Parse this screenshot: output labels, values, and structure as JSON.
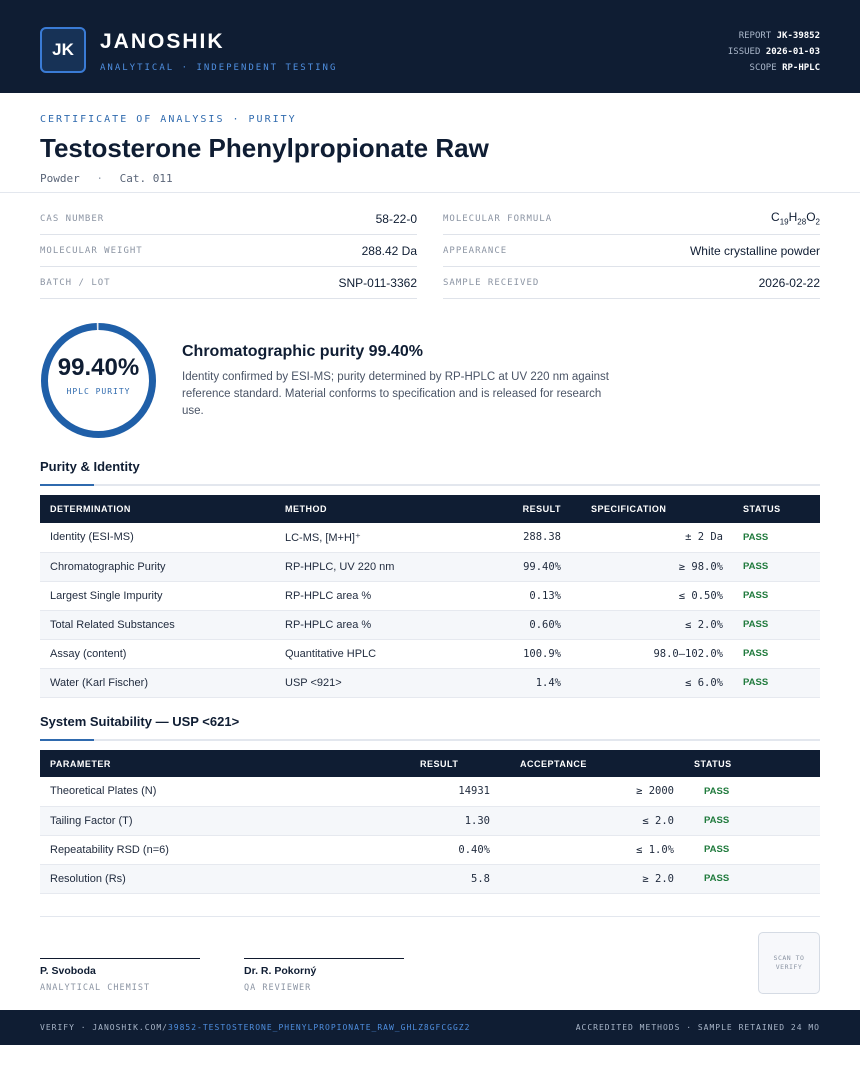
{
  "header": {
    "logo_initials": "JK",
    "brand": "JANOSHIK",
    "tagline": "ANALYTICAL · INDEPENDENT TESTING",
    "report_label": "REPORT",
    "report_value": "JK-39852",
    "issued_label": "ISSUED",
    "issued_value": "2026-01-03",
    "scope_label": "SCOPE",
    "scope_value": "RP-HPLC"
  },
  "certificate": {
    "eyebrow": "CERTIFICATE OF ANALYSIS · PURITY",
    "title": "Testosterone Phenylpropionate Raw",
    "form": "Powder",
    "catalog": "Cat. 011"
  },
  "properties": {
    "left": [
      {
        "label": "CAS NUMBER",
        "value": "58-22-0"
      },
      {
        "label": "MOLECULAR WEIGHT",
        "value": "288.42 Da"
      },
      {
        "label": "BATCH / LOT",
        "value": "SNP-011-3362"
      }
    ],
    "right": [
      {
        "label": "MOLECULAR FORMULA",
        "value": "C19H28O2"
      },
      {
        "label": "APPEARANCE",
        "value": "White crystalline powder"
      },
      {
        "label": "SAMPLE RECEIVED",
        "value": "2026-02-22"
      }
    ]
  },
  "purity": {
    "value": "99.40%",
    "fraction": 0.994,
    "label": "HPLC PURITY",
    "heading": "Chromatographic purity 99.40%",
    "description": "Identity confirmed by ESI-MS; purity determined by RP-HPLC at UV 220 nm against reference standard. Material conforms to specification and is released for research use.",
    "ring_color": "#1f5fa8"
  },
  "purity_identity": {
    "heading": "Purity & Identity",
    "columns": [
      "DETERMINATION",
      "METHOD",
      "RESULT",
      "SPECIFICATION",
      "STATUS"
    ],
    "rows": [
      [
        "Identity (ESI-MS)",
        "LC-MS, [M+H]⁺",
        "288.38",
        "± 2 Da",
        "PASS"
      ],
      [
        "Chromatographic Purity",
        "RP-HPLC, UV 220 nm",
        "99.40%",
        "≥ 98.0%",
        "PASS"
      ],
      [
        "Largest Single Impurity",
        "RP-HPLC area %",
        "0.13%",
        "≤ 0.50%",
        "PASS"
      ],
      [
        "Total Related Substances",
        "RP-HPLC area %",
        "0.60%",
        "≤ 2.0%",
        "PASS"
      ],
      [
        "Assay (content)",
        "Quantitative HPLC",
        "100.9%",
        "98.0–102.0%",
        "PASS"
      ],
      [
        "Water (Karl Fischer)",
        "USP <921>",
        "1.4%",
        "≤ 6.0%",
        "PASS"
      ]
    ]
  },
  "system_suitability": {
    "heading": "System Suitability — USP <621>",
    "columns": [
      "PARAMETER",
      "RESULT",
      "ACCEPTANCE",
      "STATUS"
    ],
    "rows": [
      [
        "Theoretical Plates (N)",
        "14931",
        "≥ 2000",
        "PASS"
      ],
      [
        "Tailing Factor (T)",
        "1.30",
        "≤ 2.0",
        "PASS"
      ],
      [
        "Repeatability RSD (n=6)",
        "0.40%",
        "≤ 1.0%",
        "PASS"
      ],
      [
        "Resolution (Rs)",
        "5.8",
        "≥ 2.0",
        "PASS"
      ]
    ]
  },
  "signatures": [
    {
      "name": "P. Svoboda",
      "role": "ANALYTICAL CHEMIST"
    },
    {
      "name": "Dr. R. Pokorný",
      "role": "QA REVIEWER"
    }
  ],
  "qr": {
    "text": "SCAN TO VERIFY"
  },
  "footer": {
    "verify_prefix": "VERIFY · JANOSHIK.COM/",
    "verify_link": "39852-TESTOSTERONE_PHENYLPROPIONATE_RAW_GHLZ8GFCGGZ2",
    "right_text": "ACCREDITED METHODS · SAMPLE RETAINED 24 MO"
  },
  "colors": {
    "navy": "#0f1d33",
    "accent": "#2f6aae",
    "pass": "#1f7a3c"
  }
}
